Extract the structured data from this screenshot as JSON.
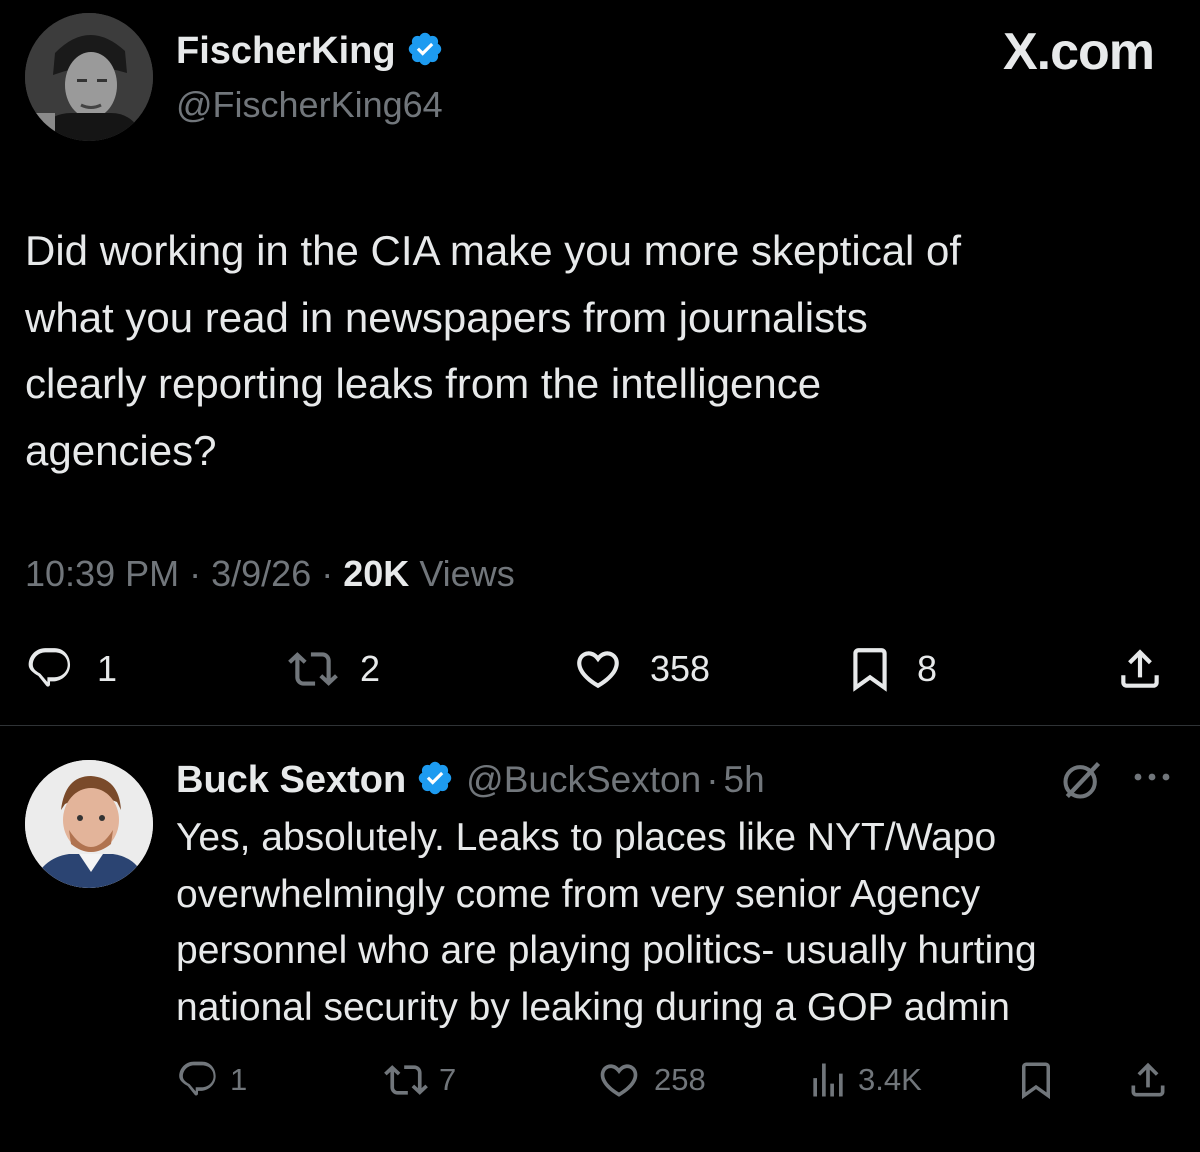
{
  "brand": {
    "logo_text": "X.com"
  },
  "tweet": {
    "author": {
      "name": "FischerKing",
      "handle": "@FischerKing64",
      "avatar_icon": "avatar-photo"
    },
    "text_lines": [
      "Did working in the CIA make you more skeptical of",
      "what you read in newspapers from journalists",
      "clearly reporting leaks from the intelligence",
      "agencies?"
    ],
    "meta": {
      "time": "10:39 PM",
      "sep1": "·",
      "date": "3/9/26",
      "sep2": "·",
      "views_count": "20K",
      "views_label": "Views"
    },
    "actions": {
      "replies": "1",
      "reposts": "2",
      "likes": "358",
      "bookmarks": "8"
    }
  },
  "reply": {
    "author": {
      "name": "Buck Sexton",
      "handle": "@BuckSexton",
      "sep": "·",
      "time": "5h",
      "avatar_icon": "avatar-photo"
    },
    "text_lines": [
      "Yes, absolutely. Leaks to places like NYT/Wapo",
      "overwhelmingly come from very senior Agency",
      "personnel who are playing politics- usually hurting",
      "national security by leaking during a GOP admin"
    ],
    "actions": {
      "replies": "1",
      "reposts": "7",
      "likes": "258",
      "views": "3.4K"
    }
  },
  "colors": {
    "verified": "#1d9bf0",
    "background": "#000000",
    "text": "#e7e9ea",
    "muted": "#71767b"
  }
}
